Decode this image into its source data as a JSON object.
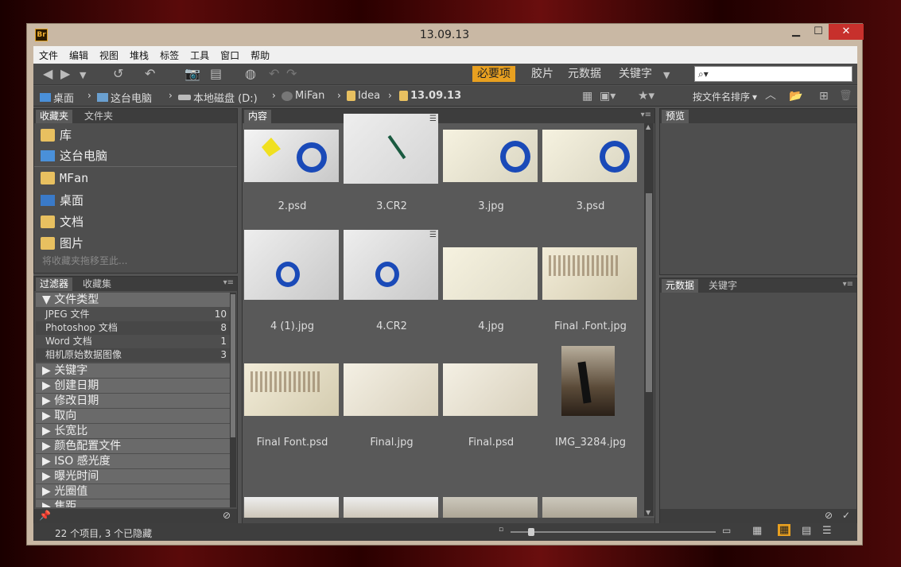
{
  "window": {
    "title": "13.09.13",
    "app_icon": "Br",
    "minimize": "▁",
    "maximize": "☐",
    "close": "✕"
  },
  "menu": [
    "文件",
    "编辑",
    "视图",
    "堆栈",
    "标签",
    "工具",
    "窗口",
    "帮助"
  ],
  "workspaces": [
    "必要项",
    "胶片",
    "元数据",
    "关键字"
  ],
  "search": {
    "placeholder": "⌕▾"
  },
  "path": [
    "桌面",
    "这台电脑",
    "本地磁盘 (D:)",
    "MiFan",
    "Idea",
    "13.09.13"
  ],
  "sort_label": "按文件名排序",
  "favorites": {
    "tabs": [
      "收藏夹",
      "文件夹"
    ],
    "items": [
      "库",
      "这台电脑",
      "MFan",
      "桌面",
      "文档",
      "图片"
    ],
    "hint": "将收藏夹拖移至此..."
  },
  "filter": {
    "tabs": [
      "过滤器",
      "收藏集"
    ],
    "file_type_header": "文件类型",
    "file_types": [
      {
        "label": "JPEG 文件",
        "count": "10"
      },
      {
        "label": "Photoshop 文档",
        "count": "8"
      },
      {
        "label": "Word 文档",
        "count": "1"
      },
      {
        "label": "相机原始数据图像",
        "count": "3"
      }
    ],
    "sections": [
      "关键字",
      "创建日期",
      "修改日期",
      "取向",
      "长宽比",
      "颜色配置文件",
      "ISO 感光度",
      "曝光时间",
      "光圈值",
      "焦距"
    ]
  },
  "content": {
    "tab": "内容",
    "items": [
      "2.psd",
      "3.CR2",
      "3.jpg",
      "3.psd",
      "4 (1).jpg",
      "4.CR2",
      "4.jpg",
      "Final .Font.jpg",
      "Final Font.psd",
      "Final.jpg",
      "Final.psd",
      "IMG_3284.jpg"
    ]
  },
  "preview": {
    "tab": "预览"
  },
  "metadata": {
    "tabs": [
      "元数据",
      "关键字"
    ]
  },
  "status": {
    "text": "22 个项目, 3 个已隐藏"
  },
  "colors": {
    "accent": "#e8a020",
    "panel": "#4e4e4e",
    "chrome": "#c9b8a4"
  }
}
